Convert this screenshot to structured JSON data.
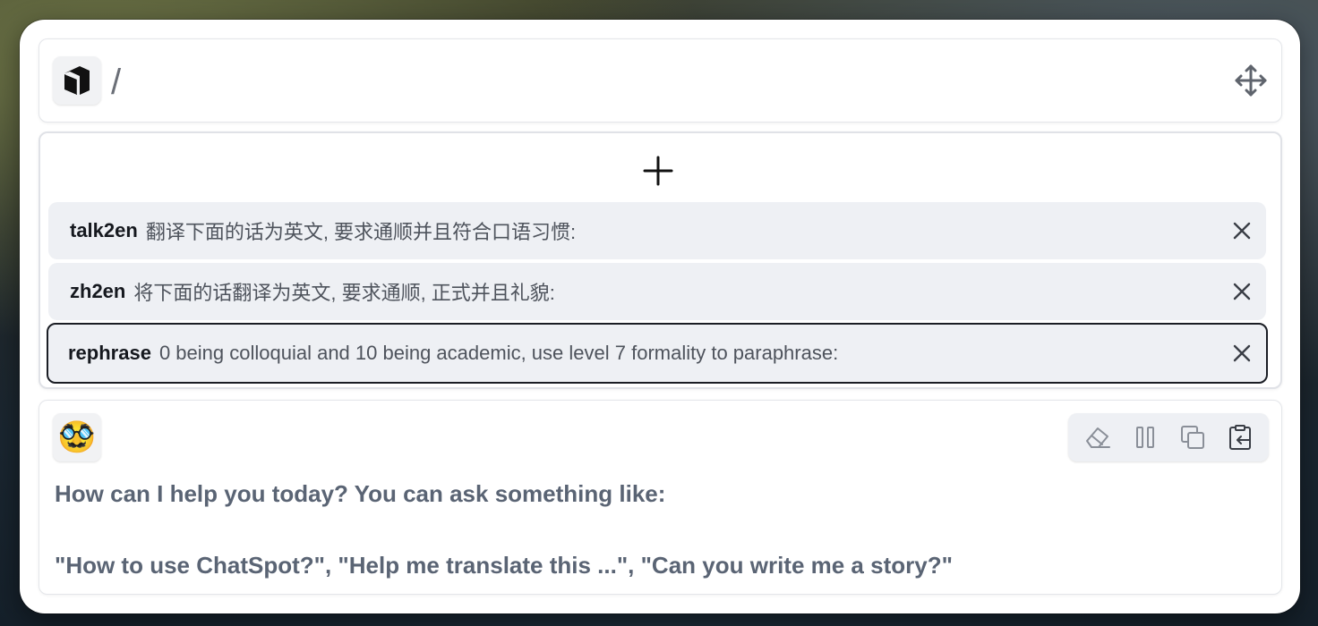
{
  "header": {
    "input_value": "/",
    "logo_icon": "book-logo-icon",
    "move_icon": "move-arrows-icon"
  },
  "prompts": {
    "add_icon": "plus-icon",
    "items": [
      {
        "name": "talk2en",
        "text": "翻译下面的话为英文, 要求通顺并且符合口语习惯:",
        "selected": false
      },
      {
        "name": "zh2en",
        "text": "将下面的话翻译为英文, 要求通顺, 正式并且礼貌:",
        "selected": false
      },
      {
        "name": "rephrase",
        "text": "0 being colloquial and 10 being academic, use level 7 formality to paraphrase:",
        "selected": true
      }
    ]
  },
  "chat": {
    "avatar_emoji": "🥸",
    "toolbar": [
      "eraser-icon",
      "pause-icon",
      "copy-icon",
      "paste-icon"
    ],
    "greeting": "How can I help you today? You can ask something like:",
    "examples": "\"How to use ChatSpot?\", \"Help me translate this ...\", \"Can you write me a story?\""
  },
  "colors": {
    "text_muted": "#5a6474",
    "item_bg": "#eef0f4",
    "selected_border": "#1a1d24"
  }
}
